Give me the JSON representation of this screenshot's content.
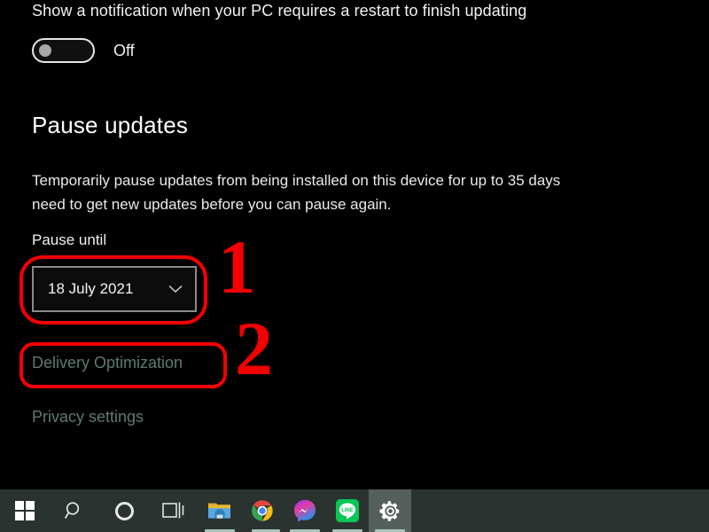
{
  "settings": {
    "notification_label": "Show a notification when your PC requires a restart to finish updating",
    "toggle": {
      "state_label": "Off",
      "state": "off"
    },
    "section": {
      "heading": "Pause updates",
      "body_line_1": "Temporarily pause updates from being installed on this device for up to 35 days",
      "body_line_2": "need to get new updates before you can pause again."
    },
    "pause_until": {
      "label": "Pause until",
      "selected_value": "18 July 2021",
      "chevron_icon": "chevron-down-icon"
    },
    "links": [
      {
        "label": "Delivery Optimization",
        "name": "delivery-optimization"
      },
      {
        "label": "Privacy settings",
        "name": "privacy-settings"
      }
    ]
  },
  "annotations": {
    "color": "#f50000",
    "items": [
      {
        "number": "1",
        "targets": "pause-until-dropdown"
      },
      {
        "number": "2",
        "targets": "delivery-optimization-link"
      }
    ]
  },
  "taskbar": {
    "background": "#2b3330",
    "items": [
      {
        "name": "start-button",
        "icon": "windows-logo-icon",
        "running": false,
        "active": false
      },
      {
        "name": "search-button",
        "icon": "search-icon",
        "running": false,
        "active": false
      },
      {
        "name": "cortana-button",
        "icon": "cortana-circle-icon",
        "running": false,
        "active": false
      },
      {
        "name": "task-view-button",
        "icon": "task-view-icon",
        "running": false,
        "active": false
      },
      {
        "name": "file-explorer-button",
        "icon": "file-explorer-icon",
        "running": true,
        "active": false
      },
      {
        "name": "chrome-button",
        "icon": "chrome-icon",
        "running": true,
        "active": false
      },
      {
        "name": "messenger-button",
        "icon": "messenger-icon",
        "running": true,
        "active": false
      },
      {
        "name": "line-button",
        "icon": "line-icon",
        "running": true,
        "active": false
      },
      {
        "name": "settings-button",
        "icon": "gear-icon",
        "running": true,
        "active": true
      }
    ]
  },
  "colors": {
    "page_background": "#000000",
    "text_primary": "#f2f2f2",
    "link": "#5f7a72",
    "annotation_red": "#f50000",
    "taskbar": "#2b3330",
    "taskbar_active": "#55605c",
    "running_indicator": "#a9c4bb"
  }
}
